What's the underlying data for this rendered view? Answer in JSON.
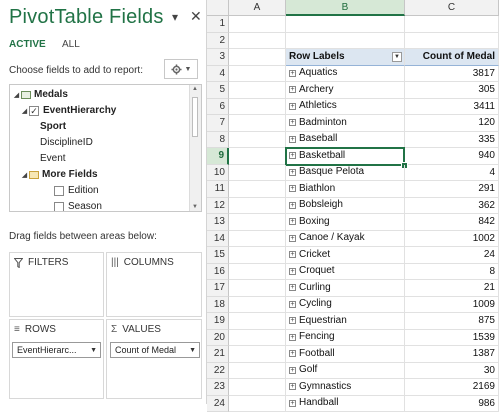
{
  "pane": {
    "title": "PivotTable Fields",
    "menu_glyph": "▾",
    "close_glyph": "✕",
    "tabs": [
      "ACTIVE",
      "ALL"
    ],
    "choose_label": "Choose fields to add to report:",
    "gear_icon": "gear-icon",
    "fields": [
      {
        "label": "Medals",
        "kind": "table",
        "bold": true
      },
      {
        "label": "EventHierarchy",
        "kind": "hierarchy",
        "checked": true,
        "bold": true
      },
      {
        "label": "Sport",
        "kind": "level",
        "bold": true
      },
      {
        "label": "DisciplineID",
        "kind": "level"
      },
      {
        "label": "Event",
        "kind": "level"
      },
      {
        "label": "More Fields",
        "kind": "folder",
        "bold": true
      },
      {
        "label": "Edition",
        "kind": "field",
        "checked": false
      },
      {
        "label": "Season",
        "kind": "field",
        "checked": false
      }
    ],
    "drag_label": "Drag fields between areas below:",
    "areas": {
      "filters": "FILTERS",
      "columns": "COLUMNS",
      "rows": "ROWS",
      "values": "VALUES"
    },
    "rows_chip": "EventHierarc...",
    "values_chip": "Count of Medal"
  },
  "sheet": {
    "columns": [
      "A",
      "B",
      "C"
    ],
    "selected_column": "B",
    "selected_row": 9,
    "header": {
      "row_labels": "Row Labels",
      "count": "Count of Medal"
    },
    "rows": [
      {
        "label": "Aquatics",
        "value": "3817"
      },
      {
        "label": "Archery",
        "value": "305"
      },
      {
        "label": "Athletics",
        "value": "3411"
      },
      {
        "label": "Badminton",
        "value": "120"
      },
      {
        "label": "Baseball",
        "value": "335"
      },
      {
        "label": "Basketball",
        "value": "940"
      },
      {
        "label": "Basque Pelota",
        "value": "4"
      },
      {
        "label": "Biathlon",
        "value": "291"
      },
      {
        "label": "Bobsleigh",
        "value": "362"
      },
      {
        "label": "Boxing",
        "value": "842"
      },
      {
        "label": "Canoe / Kayak",
        "value": "1002"
      },
      {
        "label": "Cricket",
        "value": "24"
      },
      {
        "label": "Croquet",
        "value": "8"
      },
      {
        "label": "Curling",
        "value": "21"
      },
      {
        "label": "Cycling",
        "value": "1009"
      },
      {
        "label": "Equestrian",
        "value": "875"
      },
      {
        "label": "Fencing",
        "value": "1539"
      },
      {
        "label": "Football",
        "value": "1387"
      },
      {
        "label": "Golf",
        "value": "30"
      },
      {
        "label": "Gymnastics",
        "value": "2169"
      },
      {
        "label": "Handball",
        "value": "986"
      }
    ],
    "row_numbers": [
      1,
      2,
      3,
      4,
      5,
      6,
      7,
      8,
      9,
      10,
      11,
      12,
      13,
      14,
      15,
      16,
      17,
      18,
      19,
      20,
      21,
      22,
      23,
      24
    ]
  }
}
